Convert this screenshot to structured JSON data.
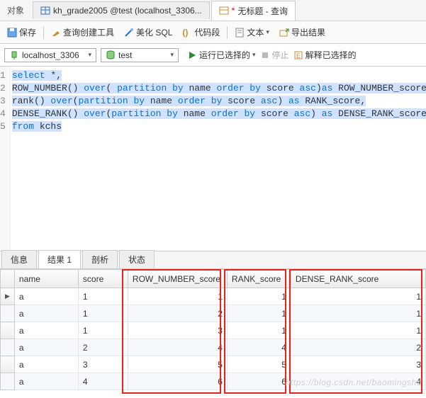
{
  "top": {
    "object_label": "对象",
    "tab1": "kh_grade2005 @test (localhost_3306...",
    "tab2_prefix": "*",
    "tab2": "无标题 - 查询"
  },
  "toolbar": {
    "save": "保存",
    "query_builder": "查询创建工具",
    "beautify": "美化 SQL",
    "snippet": "代码段",
    "text": "文本",
    "export": "导出结果"
  },
  "conn": {
    "host": "localhost_3306",
    "db": "test",
    "run": "运行已选择的",
    "stop": "停止",
    "explain": "解释已选择的"
  },
  "sql": {
    "l1a": "select",
    "l1b": " *,",
    "l2a": "ROW_NUMBER() ",
    "l2b": "over",
    "l2c": "( ",
    "l2d": "partition by",
    "l2e": " name ",
    "l2f": "order by",
    "l2g": " score ",
    "l2h": "asc",
    "l2i": ")",
    "l2j": "as",
    "l2k": " ROW_NUMBER_score ,",
    "l3a": "rank() ",
    "l3b": "over",
    "l3c": "(",
    "l3d": "partition by",
    "l3e": " name ",
    "l3f": "order by",
    "l3g": " score ",
    "l3h": "asc",
    "l3i": ") ",
    "l3j": "as",
    "l3k": " RANK_score,",
    "l4a": "DENSE_RANK() ",
    "l4b": "over",
    "l4c": "(",
    "l4d": "partition by",
    "l4e": " name ",
    "l4f": "order by",
    "l4g": " score ",
    "l4h": "asc",
    "l4i": ") ",
    "l4j": "as",
    "l4k": " DENSE_RANK_score",
    "l5a": "from",
    "l5b": " kchs"
  },
  "lines": {
    "n1": "1",
    "n2": "2",
    "n3": "3",
    "n4": "4",
    "n5": "5"
  },
  "bottom_tabs": {
    "info": "信息",
    "result": "结果 1",
    "profile": "剖析",
    "status": "状态"
  },
  "grid": {
    "headers": {
      "name": "name",
      "score": "score",
      "rownum": "ROW_NUMBER_score",
      "rank": "RANK_score",
      "dense": "DENSE_RANK_score"
    },
    "rows": [
      {
        "mark": "▶",
        "name": "a",
        "score": "1",
        "rownum": "1",
        "rank": "1",
        "dense": "1"
      },
      {
        "mark": "",
        "name": "a",
        "score": "1",
        "rownum": "2",
        "rank": "1",
        "dense": "1"
      },
      {
        "mark": "",
        "name": "a",
        "score": "1",
        "rownum": "3",
        "rank": "1",
        "dense": "1"
      },
      {
        "mark": "",
        "name": "a",
        "score": "2",
        "rownum": "4",
        "rank": "4",
        "dense": "2"
      },
      {
        "mark": "",
        "name": "a",
        "score": "3",
        "rownum": "5",
        "rank": "5",
        "dense": "3"
      },
      {
        "mark": "",
        "name": "a",
        "score": "4",
        "rownum": "6",
        "rank": "6",
        "dense": "4"
      }
    ]
  },
  "watermark": "https://blog.csdn.net/baomingshu"
}
